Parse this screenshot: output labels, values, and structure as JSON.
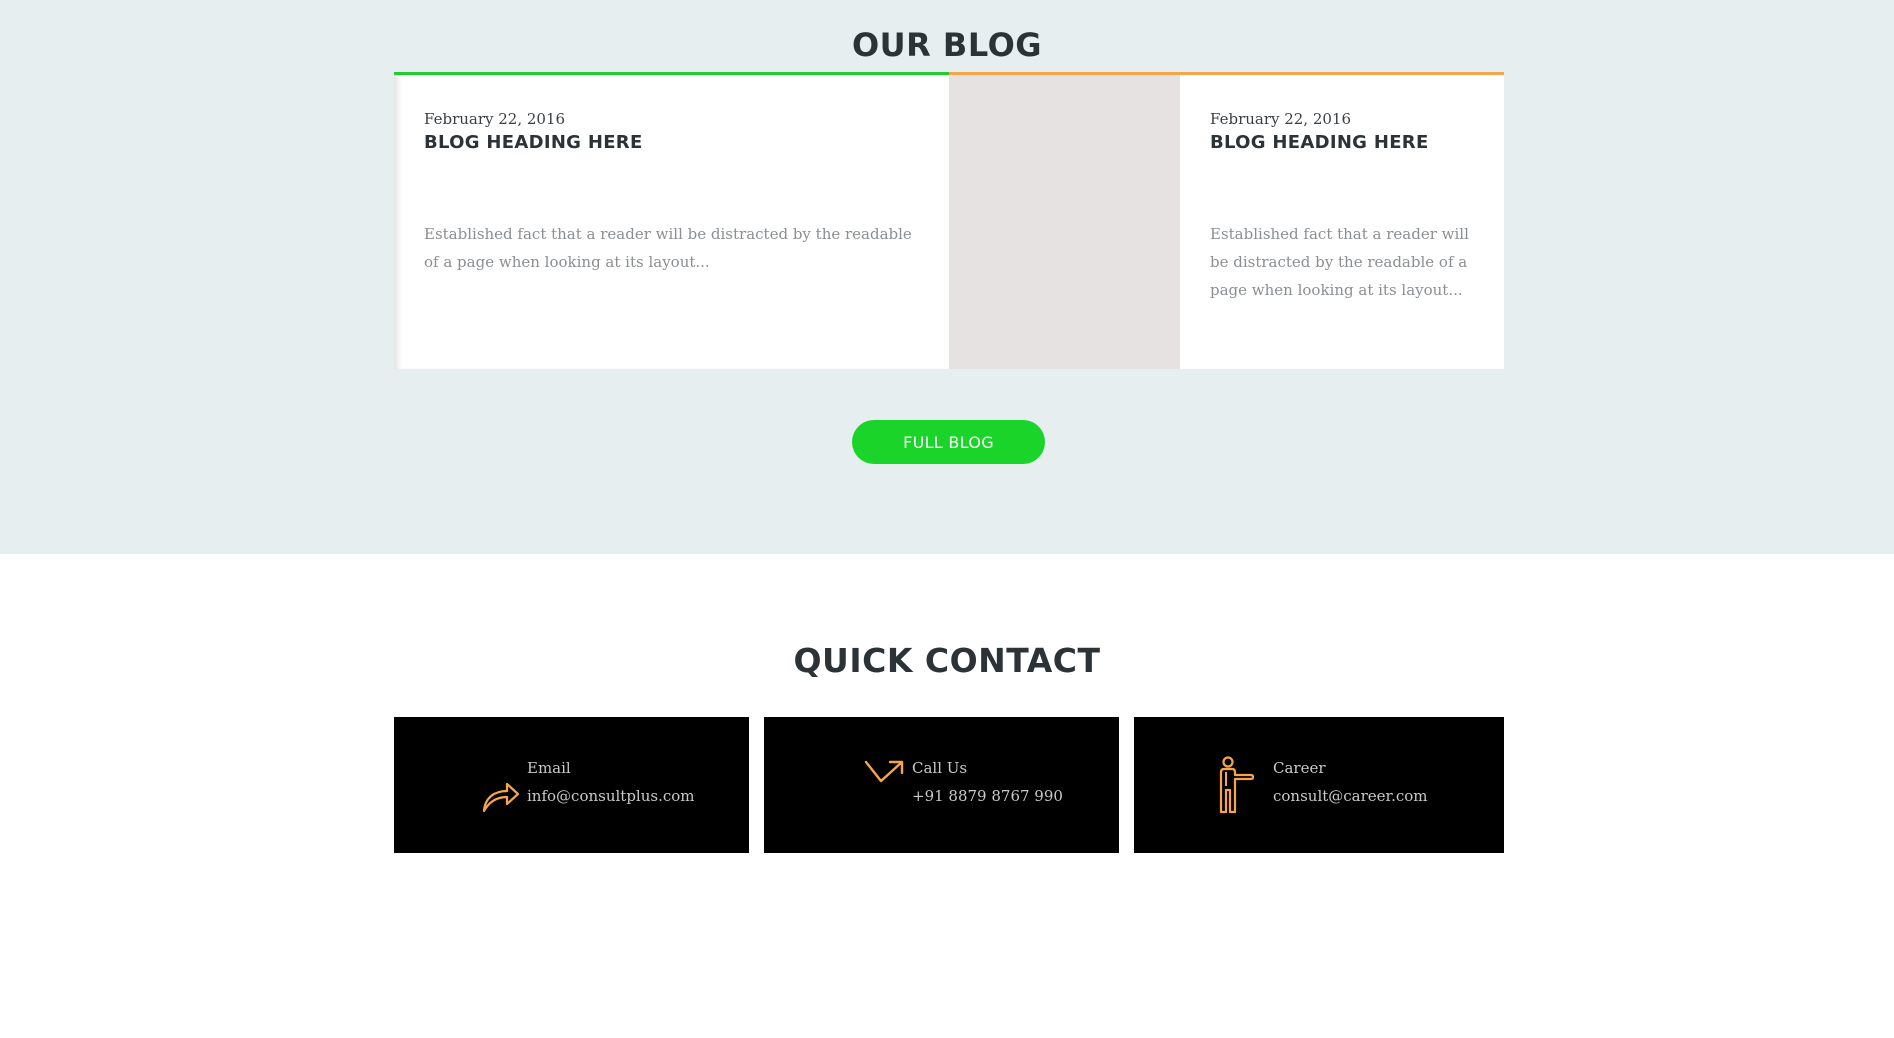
{
  "blog": {
    "title": "OUR BLOG",
    "posts": [
      {
        "date": "February 22, 2016",
        "heading": "BLOG HEADING HERE",
        "excerpt": "Established fact that a reader will be distracted by the readable of a page when looking at its layout..."
      },
      {
        "date": "February 22, 2016",
        "heading": "BLOG HEADING HERE",
        "excerpt": "Established fact that a reader will be distracted by the readable of a page when looking at its layout..."
      }
    ],
    "full_blog_label": "FULL BLOG"
  },
  "contact": {
    "title": "QUICK CONTACT",
    "items": [
      {
        "icon": "share-arrow-icon",
        "label": "Email",
        "value": "info@consultplus.com"
      },
      {
        "icon": "trend-arrow-icon",
        "label": "Call Us",
        "value": "+91 8879 8767 990"
      },
      {
        "icon": "person-pointing-icon",
        "label": "Career",
        "value": "consult@career.com"
      }
    ]
  },
  "colors": {
    "accent_green": "#1ad42a",
    "accent_orange": "#f7a54c",
    "section_bg": "#e7eef0",
    "heading_text": "#2b3336"
  }
}
